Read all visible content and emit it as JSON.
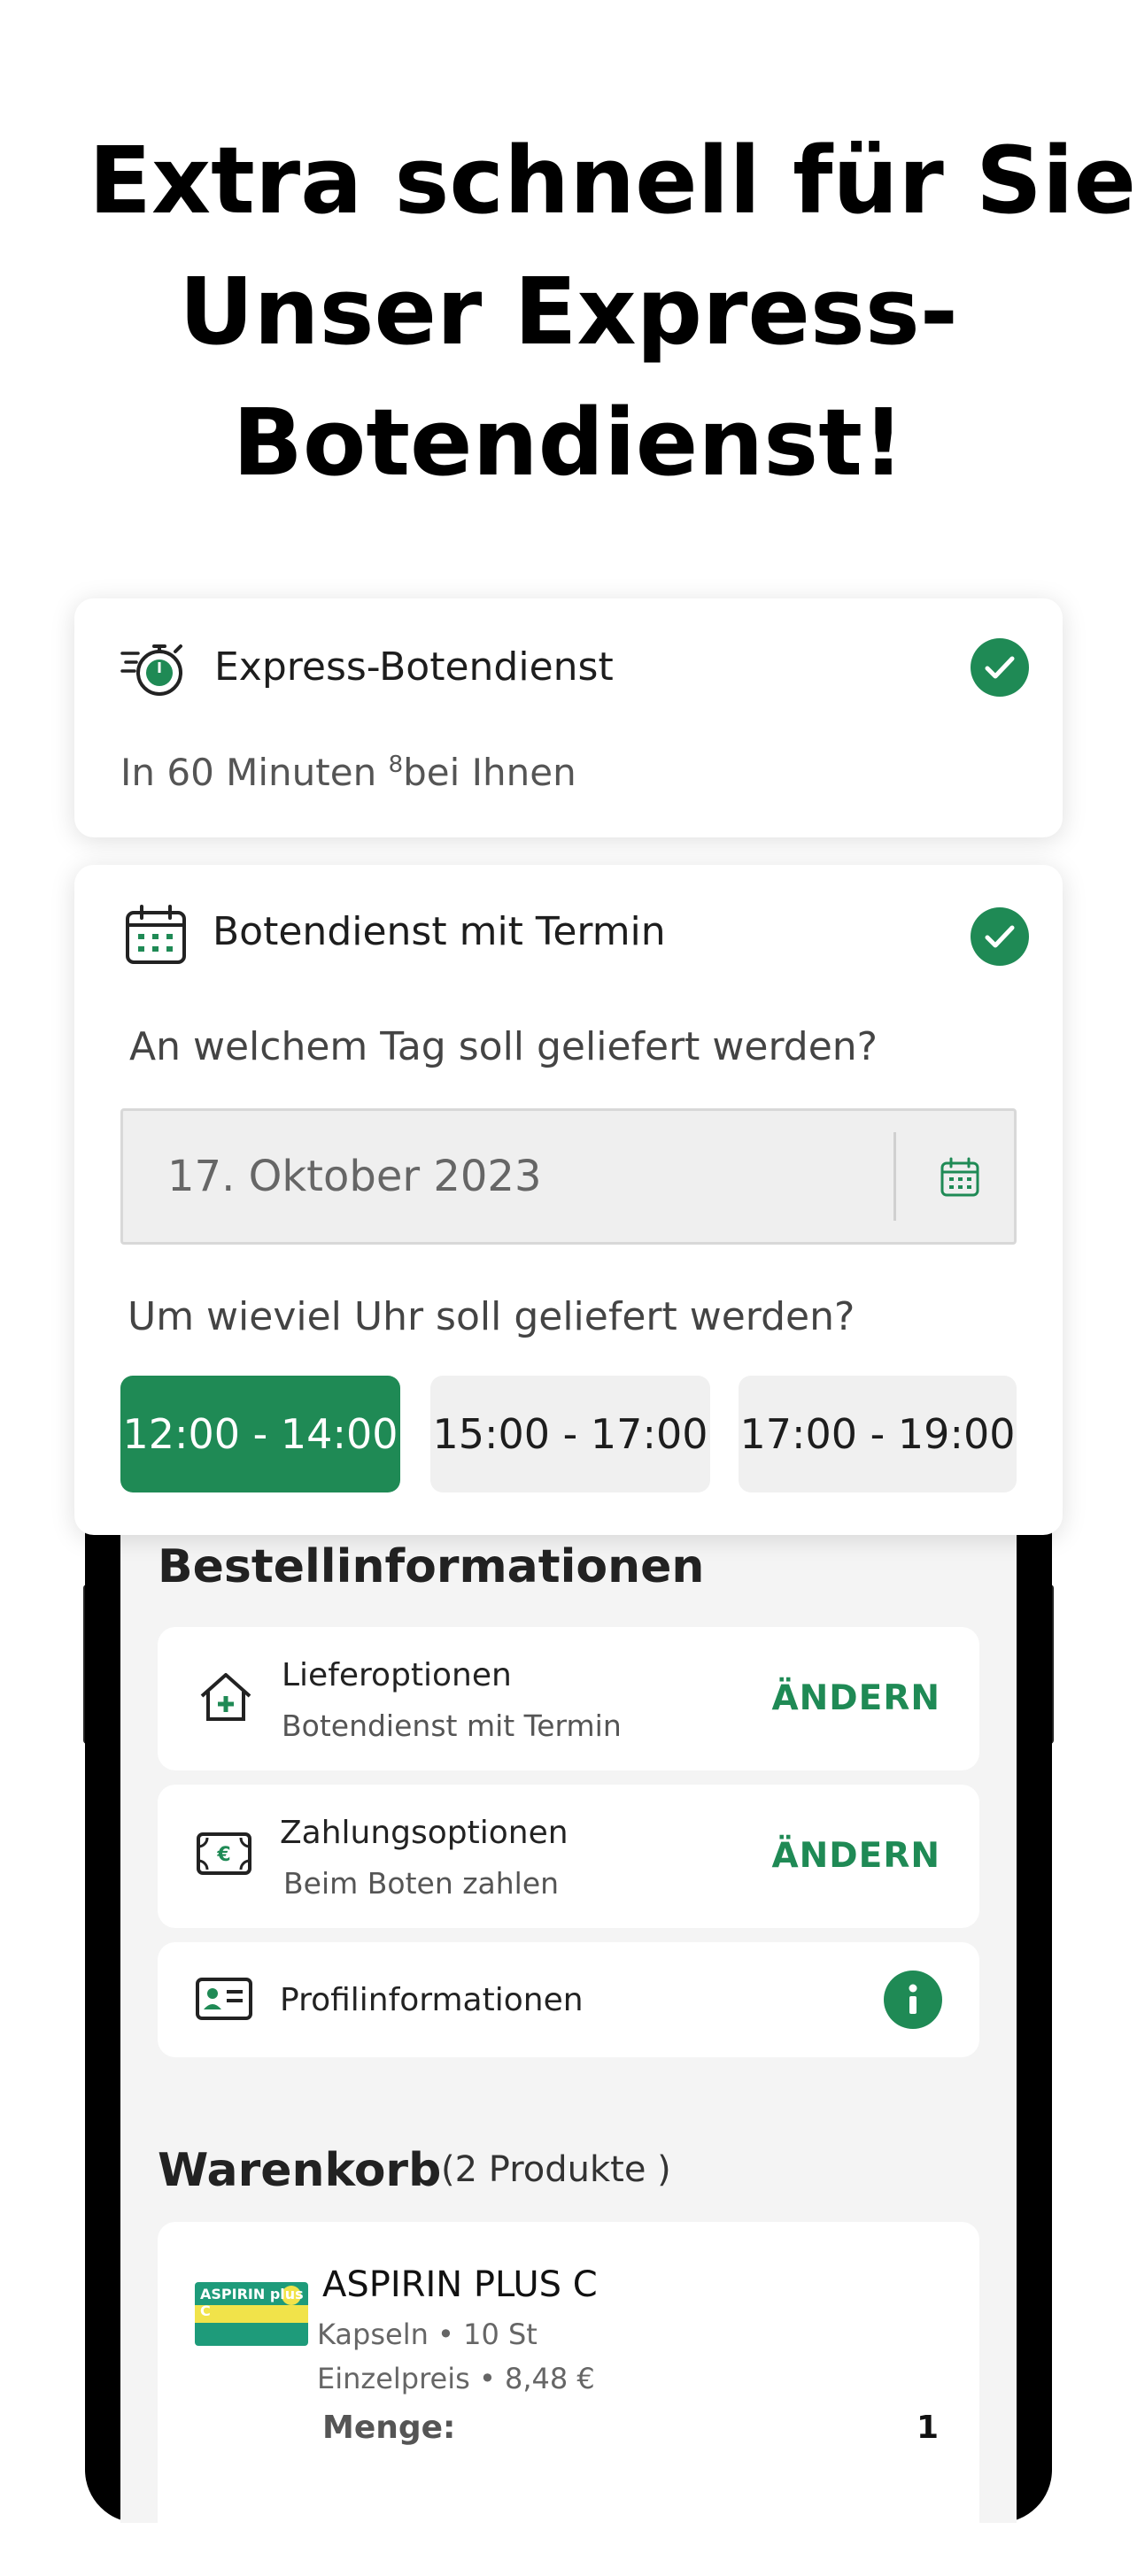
{
  "headline": {
    "line1": "Extra schnell für Sie:",
    "line2": "Unser Express-",
    "line3": "Botendienst!"
  },
  "express_card": {
    "title": "Express-Botendienst",
    "sub_prefix": "In 60 Minuten ",
    "sub_sup": "8",
    "sub_suffix": "bei Ihnen",
    "icon": "stopwatch-icon",
    "checked": true
  },
  "termin_card": {
    "title": "Botendienst mit Termin",
    "icon": "calendar-icon",
    "checked": true,
    "day_question": "An welchem Tag soll geliefert werden?",
    "date_value": "17. Oktober 2023",
    "time_question": "Um wieviel Uhr soll geliefert werden?",
    "slots": [
      {
        "label": "12:00 - 14:00",
        "selected": true
      },
      {
        "label": "15:00 - 17:00",
        "selected": false
      },
      {
        "label": "17:00 - 19:00",
        "selected": false
      }
    ]
  },
  "order_info": {
    "title": "Bestellinformationen",
    "delivery": {
      "title": "Lieferoptionen",
      "value": "Botendienst mit Termin",
      "action": "ÄNDERN",
      "icon": "house-plus-icon"
    },
    "payment": {
      "title": "Zahlungsoptionen",
      "value": "Beim Boten zahlen",
      "action": "ÄNDERN",
      "icon": "euro-cash-icon"
    },
    "profile": {
      "title": "Profilinformationen",
      "icon": "id-card-icon",
      "action_icon": "info-icon"
    }
  },
  "cart": {
    "title": "Warenkorb",
    "count": "(2 Produkte )",
    "items": [
      {
        "name": "ASPIRIN PLUS C",
        "meta": "Kapseln • 10 St",
        "price": "Einzelpreis • 8,48 €",
        "qty_label": "Menge:",
        "qty": "1",
        "image_text": "ASPIRIN plus C"
      }
    ]
  },
  "colors": {
    "accent": "#1f8a55",
    "card_bg": "#ffffff",
    "screen_bg": "#f4f4f4",
    "inactive_slot": "#f0f0f0"
  }
}
